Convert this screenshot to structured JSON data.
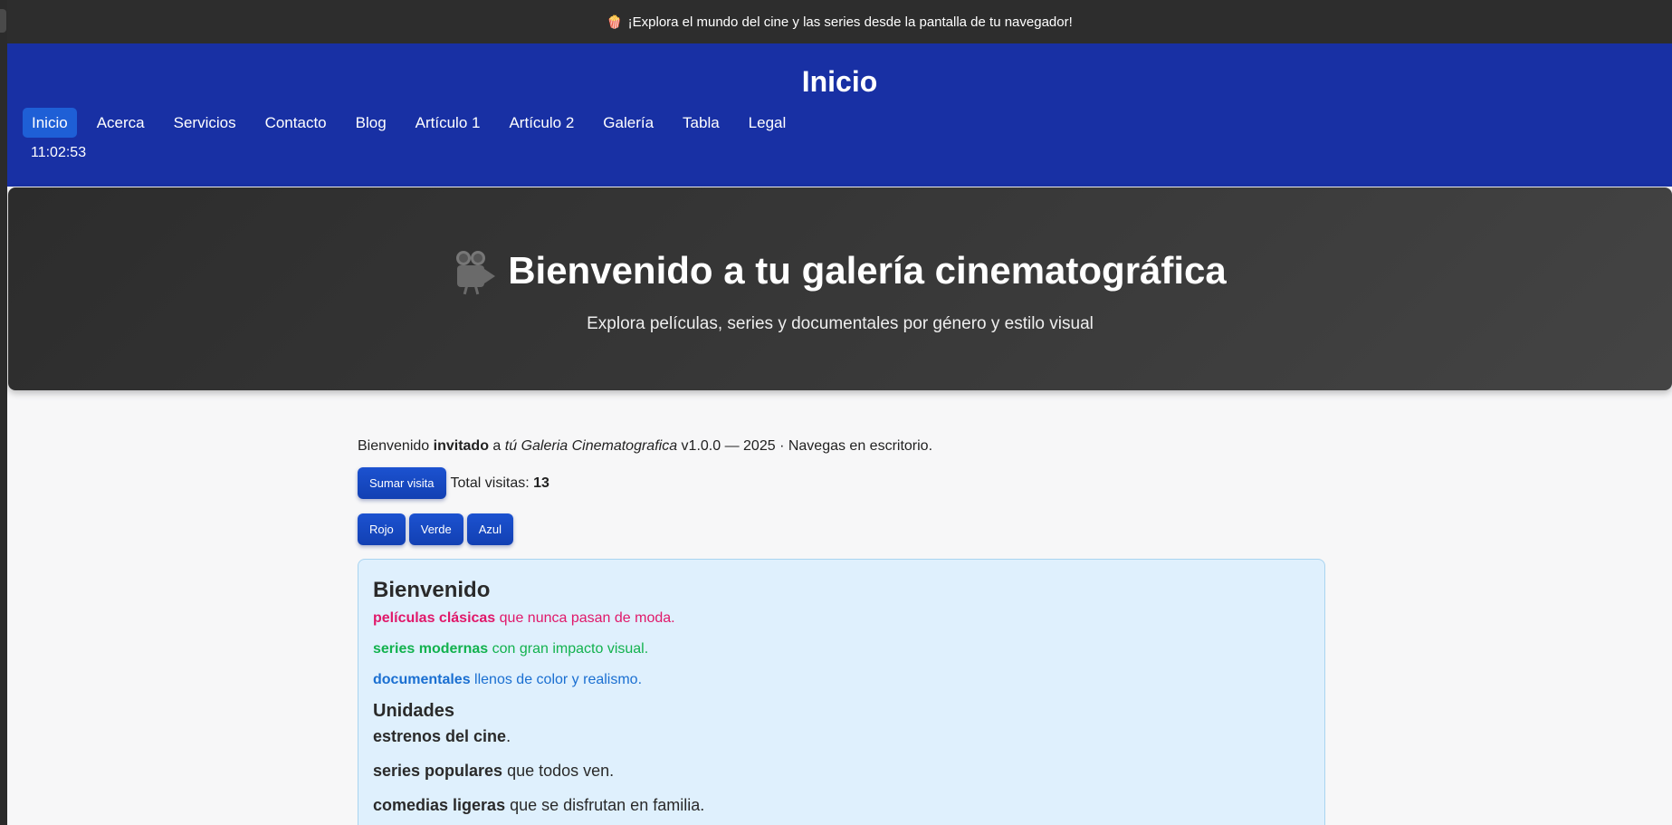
{
  "announcement": {
    "icon": "popcorn-icon",
    "text": "¡Explora el mundo del cine y las series desde la pantalla de tu navegador!"
  },
  "header": {
    "title": "Inicio",
    "nav": [
      {
        "label": "Inicio",
        "active": true
      },
      {
        "label": "Acerca"
      },
      {
        "label": "Servicios"
      },
      {
        "label": "Contacto"
      },
      {
        "label": "Blog"
      },
      {
        "label": "Artículo 1"
      },
      {
        "label": "Artículo 2"
      },
      {
        "label": "Galería"
      },
      {
        "label": "Tabla"
      },
      {
        "label": "Legal"
      }
    ],
    "clock": "11:02:53"
  },
  "hero": {
    "icon": "movie-camera-icon",
    "title": "Bienvenido a tu galería cinematográfica",
    "subtitle": "Explora películas, series y documentales por género y estilo visual"
  },
  "main": {
    "welcome": {
      "prefix": "Bienvenido",
      "user": "invitado",
      "mid": "a",
      "app": "tú Galeria Cinematografica",
      "suffix": "v1.0.0 — 2025 · Navegas en escritorio."
    },
    "visit_button": "Sumar visita",
    "visits_label": "Total visitas:",
    "visits_count": "13",
    "color_buttons": {
      "red": "Rojo",
      "green": "Verde",
      "blue": "Azul"
    },
    "card": {
      "title": "Bienvenido",
      "lines": [
        {
          "strong": "películas clásicas",
          "rest": "que nunca pasan de moda."
        },
        {
          "strong": "series modernas",
          "rest": "con gran impacto visual."
        },
        {
          "strong": "documentales",
          "rest": "llenos de color y realismo."
        }
      ],
      "subtitle": "Unidades",
      "items": [
        {
          "strong": "estrenos del cine",
          "rest": "."
        },
        {
          "strong": "series populares",
          "rest": "que todos ven."
        },
        {
          "strong": "comedias ligeras",
          "rest": "que se disfrutan en familia."
        }
      ]
    }
  },
  "colors": {
    "topbar": "#2d2d2d",
    "header": "#1830a4",
    "nav_active": "#1e5fd6",
    "button": "#1c52d0",
    "card_bg": "#dff0fd",
    "pink": "#e0186a",
    "green": "#12b24e",
    "blue": "#1a6fd1"
  }
}
